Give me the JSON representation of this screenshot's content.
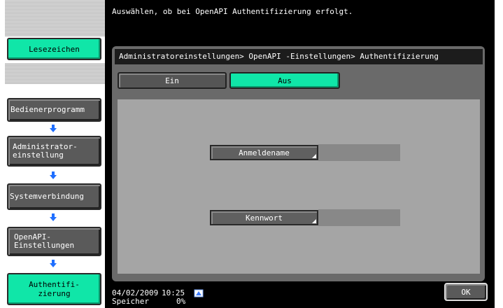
{
  "message": "Auswählen, ob bei OpenAPI Authentifizierung erfolgt.",
  "sidebar": {
    "bookmark_label": "Lesezeichen",
    "steps": [
      {
        "label": "Bedienerprogramm"
      },
      {
        "label": "Administrator-\neinstellung"
      },
      {
        "label": "Systemverbindung"
      },
      {
        "label": "OpenAPI-\nEinstellungen"
      },
      {
        "label": "Authentifi-\nzierung"
      }
    ]
  },
  "panel": {
    "breadcrumb": "Administratoreinstellungen> OpenAPI -Einstellungen> Authentifizierung",
    "toggle": {
      "on_label": "Ein",
      "off_label": "Aus",
      "selected": "Aus"
    },
    "fields": [
      {
        "label": "Anmeldename",
        "value": ""
      },
      {
        "label": "Kennwort",
        "value": ""
      }
    ]
  },
  "status": {
    "date": "04/02/2009",
    "time": "10:25",
    "memory_label": "Speicher",
    "memory_value": "0%"
  },
  "ok_label": "OK",
  "colors": {
    "accent": "#10e6a8",
    "panel_bg": "#a5a5a5",
    "main_bg": "#000000"
  }
}
